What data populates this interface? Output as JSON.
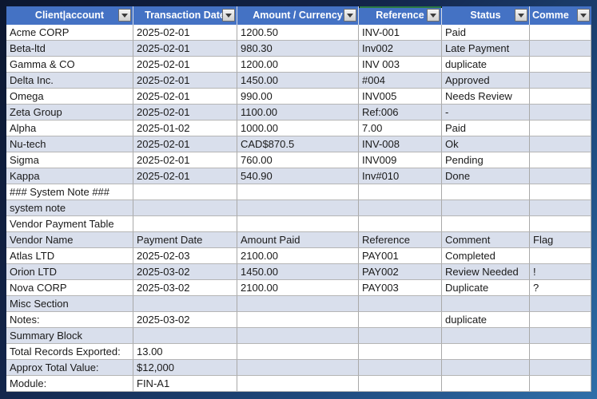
{
  "table": {
    "header": {
      "columns": [
        {
          "label": "Client|account",
          "filter": true
        },
        {
          "label": "Transaction Date",
          "filter": true
        },
        {
          "label": "Amount / Currency",
          "filter": true
        },
        {
          "label": "Reference",
          "filter": true,
          "active": true
        },
        {
          "label": "Status",
          "filter": true
        },
        {
          "label": "Comme",
          "filter": true
        }
      ]
    },
    "rows": [
      {
        "cells": [
          "Acme CORP",
          "2025-02-01",
          "1200.50",
          "INV-001",
          "Paid",
          ""
        ]
      },
      {
        "cells": [
          "Beta-ltd",
          "2025-02-01",
          "980.30",
          "Inv002",
          "Late Payment",
          ""
        ]
      },
      {
        "cells": [
          "Gamma & CO",
          "2025-02-01",
          "1200.00",
          "INV 003",
          "duplicate",
          ""
        ]
      },
      {
        "cells": [
          "Delta Inc.",
          "2025-02-01",
          "1450.00",
          "#004",
          "Approved",
          ""
        ]
      },
      {
        "cells": [
          "Omega",
          "2025-02-01",
          "990.00",
          "INV005",
          "Needs Review",
          ""
        ]
      },
      {
        "cells": [
          "Zeta Group",
          "2025-02-01",
          "1100.00",
          "Ref:006",
          "-",
          ""
        ]
      },
      {
        "cells": [
          "Alpha",
          "2025-01-02",
          "1000.00",
          "7.00",
          "Paid",
          ""
        ]
      },
      {
        "cells": [
          "Nu-tech",
          "2025-02-01",
          "CAD$870.5",
          "INV-008",
          "Ok",
          ""
        ]
      },
      {
        "cells": [
          "Sigma",
          "2025-02-01",
          "760.00",
          "INV009",
          "Pending",
          ""
        ]
      },
      {
        "cells": [
          "Kappa",
          "2025-02-01",
          "540.90",
          "Inv#010",
          "Done",
          ""
        ]
      },
      {
        "cells": [
          "### System Note ###",
          "",
          "",
          "",
          "",
          ""
        ]
      },
      {
        "cells": [
          "system note",
          "",
          "",
          "",
          "",
          ""
        ]
      },
      {
        "cells": [
          "Vendor Payment Table",
          "",
          "",
          "",
          "",
          ""
        ]
      },
      {
        "cells": [
          "Vendor Name",
          "Payment Date",
          "Amount Paid",
          "Reference",
          "Comment",
          "Flag"
        ]
      },
      {
        "cells": [
          "Atlas LTD",
          "2025-02-03",
          "2100.00",
          "PAY001",
          "Completed",
          ""
        ]
      },
      {
        "cells": [
          "Orion LTD",
          "2025-03-02",
          "1450.00",
          "PAY002",
          "Review Needed",
          "!"
        ]
      },
      {
        "cells": [
          "Nova CORP",
          "2025-03-02",
          "2100.00",
          "PAY003",
          "Duplicate",
          "?"
        ]
      },
      {
        "cells": [
          "Misc Section",
          "",
          "",
          "",
          "",
          ""
        ]
      },
      {
        "cells": [
          "Notes:",
          "2025-03-02",
          "",
          "",
          "duplicate",
          ""
        ]
      },
      {
        "cells": [
          "Summary Block",
          "",
          "",
          "",
          "",
          ""
        ]
      },
      {
        "cells": [
          "Total Records Exported:",
          "13.00",
          "",
          "",
          "",
          ""
        ]
      },
      {
        "cells": [
          "Approx Total Value:",
          "$12,000",
          "",
          "",
          "",
          ""
        ]
      },
      {
        "cells": [
          "Module:",
          "FIN-A1",
          "",
          "",
          "",
          ""
        ]
      }
    ],
    "colors": {
      "header_bg": "#4472C4",
      "header_text": "#FFFFFF",
      "band_row": "#D9DFEC",
      "gridline": "#A9A9A9",
      "active_column_indicator": "#2B7A44"
    }
  }
}
